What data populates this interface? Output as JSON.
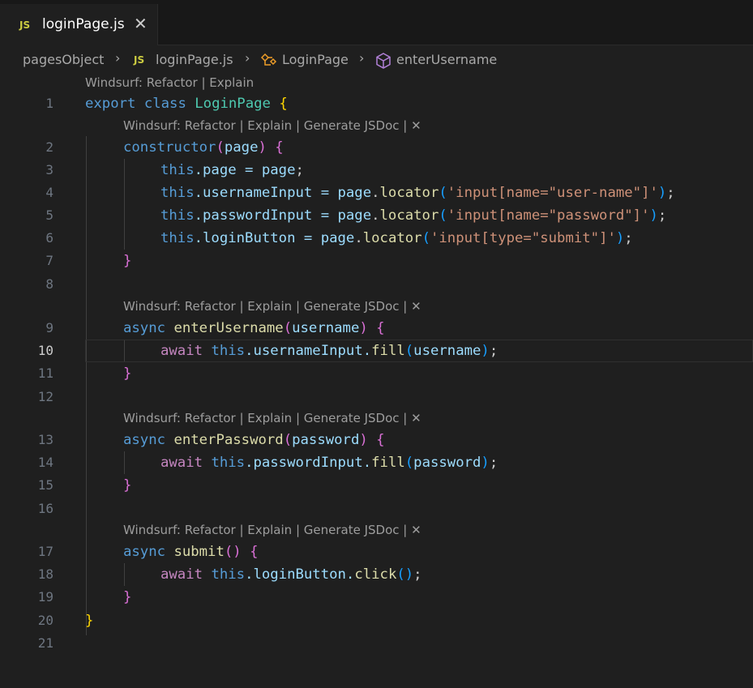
{
  "tab": {
    "badge": "JS",
    "label": "loginPage.js",
    "close": "✕"
  },
  "breadcrumb": {
    "folder": "pagesObject",
    "file_badge": "JS",
    "file": "loginPage.js",
    "class": "LoginPage",
    "method": "enterUsername",
    "separator": "›"
  },
  "codelens": {
    "class_lens": "Windsurf: Refactor | Explain",
    "method_lens": "Windsurf: Refactor | Explain | Generate JSDoc |",
    "close": "✕"
  },
  "editor": {
    "active_line": 10,
    "line_numbers": [
      "1",
      "2",
      "3",
      "4",
      "5",
      "6",
      "7",
      "8",
      "9",
      "10",
      "11",
      "12",
      "13",
      "14",
      "15",
      "16",
      "17",
      "18",
      "19",
      "20",
      "21"
    ],
    "code": {
      "l1": [
        "export",
        " ",
        "class",
        " ",
        "LoginPage",
        " ",
        "{"
      ],
      "l2": [
        "constructor",
        "(",
        "page",
        ")",
        " ",
        "{"
      ],
      "l3": [
        "this",
        ".page = ",
        "page",
        ";"
      ],
      "l4": [
        "this",
        ".usernameInput = ",
        "page",
        ".",
        "locator",
        "(",
        "'input[name=\"user-name\"]'",
        ")",
        ";"
      ],
      "l5": [
        "this",
        ".passwordInput = ",
        "page",
        ".",
        "locator",
        "(",
        "'input[name=\"password\"]'",
        ")",
        ";"
      ],
      "l6": [
        "this",
        ".loginButton = ",
        "page",
        ".",
        "locator",
        "(",
        "'input[type=\"submit\"]'",
        ")",
        ";"
      ],
      "l7": [
        "}"
      ],
      "l9": [
        "async",
        " ",
        "enterUsername",
        "(",
        "username",
        ")",
        " ",
        "{"
      ],
      "l10": [
        "await",
        " ",
        "this",
        ".usernameInput.",
        "fill",
        "(",
        "username",
        ")",
        ";"
      ],
      "l11": [
        "}"
      ],
      "l13": [
        "async",
        " ",
        "enterPassword",
        "(",
        "password",
        ")",
        " ",
        "{"
      ],
      "l14": [
        "await",
        " ",
        "this",
        ".passwordInput.",
        "fill",
        "(",
        "password",
        ")",
        ";"
      ],
      "l15": [
        "}"
      ],
      "l17": [
        "async",
        " ",
        "submit",
        "(",
        ")",
        " ",
        "{"
      ],
      "l18": [
        "await",
        " ",
        "this",
        ".loginButton.",
        "click",
        "(",
        ")",
        ";"
      ],
      "l19": [
        "}"
      ],
      "l20": [
        "}"
      ]
    }
  },
  "colors": {
    "background": "#1f1f1f",
    "keyword": "#569cd6",
    "control": "#c586c0",
    "class": "#4ec9b0",
    "function": "#dcdcaa",
    "variable": "#9cdcfe",
    "string": "#ce9178",
    "js_badge": "#cbcb41"
  },
  "icons": [
    "js-file-icon",
    "class-icon",
    "method-cube-icon",
    "close-icon",
    "chevron-right-icon"
  ]
}
